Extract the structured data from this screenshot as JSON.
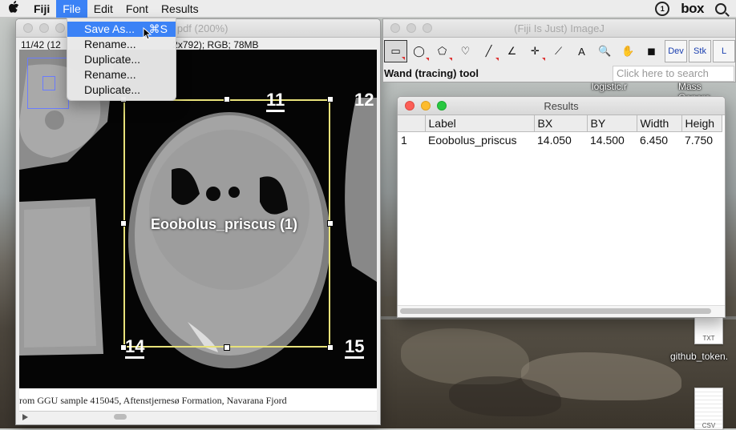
{
  "menubar": {
    "app_name": "Fiji",
    "menus": [
      "File",
      "Edit",
      "Font",
      "Results"
    ],
    "active_menu": "File",
    "status_icons": [
      "1password-icon",
      "box-logo",
      "spotlight-search-icon"
    ],
    "box_label": "box"
  },
  "file_menu": {
    "items": [
      {
        "label": "Save As...",
        "shortcut": "⌘S",
        "selected": true
      },
      {
        "label": "Rename...",
        "shortcut": ""
      },
      {
        "label": "Duplicate...",
        "shortcut": ""
      },
      {
        "label": "Rename...",
        "shortcut": ""
      },
      {
        "label": "Duplicate...",
        "shortcut": ""
      }
    ]
  },
  "image_window": {
    "title": "9.pdf (200%)",
    "info": "11/42 (12",
    "info_suffix": "2x792); RGB; 78MB",
    "overlay_label": "Eoobolus_priscus (1)",
    "specimen_numbers": [
      "11",
      "12",
      "14",
      "15"
    ],
    "caption": "rom GGU sample 415045, Aftenstjernesø Formation, Navarana Fjord"
  },
  "imagej_window": {
    "title": "(Fiji Is Just) ImageJ",
    "tools": [
      {
        "name": "rectangle-tool-icon",
        "glyph": "▭",
        "selected": true,
        "menu": true
      },
      {
        "name": "oval-tool-icon",
        "glyph": "◯",
        "menu": true
      },
      {
        "name": "polygon-tool-icon",
        "glyph": "⬠",
        "menu": true
      },
      {
        "name": "freehand-tool-icon",
        "glyph": "♡",
        "menu": false
      },
      {
        "name": "line-tool-icon",
        "glyph": "╱",
        "menu": true
      },
      {
        "name": "angle-tool-icon",
        "glyph": "∠",
        "menu": false
      },
      {
        "name": "point-tool-icon",
        "glyph": "✛",
        "menu": true
      },
      {
        "name": "wand-tool-icon",
        "glyph": "⟋",
        "menu": false
      },
      {
        "name": "text-tool-icon",
        "glyph": "A",
        "menu": false
      },
      {
        "name": "magnifier-tool-icon",
        "glyph": "🔍",
        "menu": false
      },
      {
        "name": "hand-tool-icon",
        "glyph": "✋",
        "menu": false
      },
      {
        "name": "color-picker-icon",
        "glyph": "◼",
        "menu": false
      }
    ],
    "extra_tools": [
      "Dev",
      "Stk",
      "L"
    ],
    "status": "Wand (tracing) tool",
    "search_placeholder": "Click here to search"
  },
  "results_window": {
    "title": "Results",
    "columns": [
      "",
      "Label",
      "BX",
      "BY",
      "Width",
      "Heigh"
    ],
    "rows": [
      [
        "1",
        "Eoobolus_priscus",
        "14.050",
        "14.500",
        "6.450",
        "7.750"
      ]
    ]
  },
  "desktop": {
    "items": [
      "logistic.r",
      "Mass Genera",
      "TXT",
      "github_token.",
      "CSV"
    ]
  },
  "colors": {
    "accent": "#3b82f6",
    "selection_box": "#e8e27a"
  }
}
